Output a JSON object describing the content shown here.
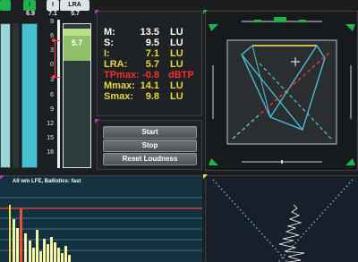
{
  "meters": {
    "lra_header_label": "LRA",
    "i_header_label": "I",
    "s_header_value": "6.9",
    "i_value": "7.1",
    "lra_value": "5.7",
    "overlay_value": "5.7",
    "scale_ticks": [
      "9",
      "6",
      "3",
      "0",
      "3",
      "6",
      "9",
      "12",
      "15",
      "18"
    ]
  },
  "readout": {
    "rows": [
      {
        "label": "M:",
        "value": "13.5",
        "unit": "LU",
        "color": "#ffffff"
      },
      {
        "label": "S:",
        "value": "9.5",
        "unit": "LU",
        "color": "#ffffff"
      },
      {
        "label": "I:",
        "value": "7.1",
        "unit": "LU",
        "color": "#e7d63a"
      },
      {
        "label": "LRA:",
        "value": "5.7",
        "unit": "LU",
        "color": "#e7d63a"
      },
      {
        "label": "TPmax:",
        "value": "-0.8",
        "unit": "dBTP",
        "color": "#ff2b2b"
      },
      {
        "label": "Mmax:",
        "value": "14.1",
        "unit": "LU",
        "color": "#e7d63a"
      },
      {
        "label": "Smax:",
        "value": "9.8",
        "unit": "LU",
        "color": "#e7d63a"
      }
    ]
  },
  "controls": {
    "start": "Start",
    "stop": "Stop",
    "reset": "Reset Loudness"
  },
  "histogram": {
    "title": "All w/o LFE, Ballistics: fast"
  },
  "colors": {
    "accent_green": "#21b24b",
    "yellow": "#e7d63a",
    "red": "#ff2b2b",
    "cyan": "#4ec3d8"
  }
}
